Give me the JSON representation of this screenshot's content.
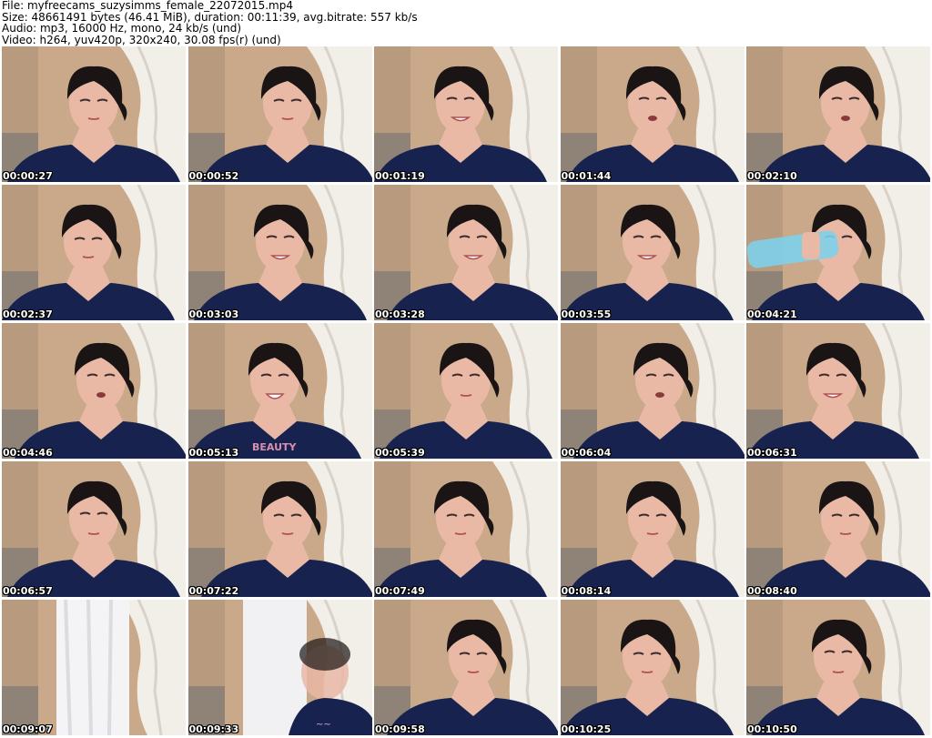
{
  "header": {
    "file": "File: myfreecams_suzysimms_female_22072015.mp4",
    "size": "Size: 48661491 bytes (46.41 MiB), duration: 00:11:39, avg.bitrate: 557 kb/s",
    "audio": "Audio: mp3, 16000 Hz, mono, 24 kb/s (und)",
    "video": "Video: h264, yuv420p, 320x240, 30.08 fps(r) (und)"
  },
  "colors": {
    "wall": "#c9a98a",
    "curtain": "#f2eee8",
    "shirt": "#17234e",
    "hair": "#1a1414",
    "skin": "#e9b9a6"
  },
  "thumbnails": [
    {
      "time": "00:00:27",
      "variant": "look-down"
    },
    {
      "time": "00:00:52",
      "variant": "look-down"
    },
    {
      "time": "00:01:19",
      "variant": "smile"
    },
    {
      "time": "00:01:44",
      "variant": "talk"
    },
    {
      "time": "00:02:10",
      "variant": "talk"
    },
    {
      "time": "00:02:37",
      "variant": "look-down"
    },
    {
      "time": "00:03:03",
      "variant": "smile"
    },
    {
      "time": "00:03:28",
      "variant": "smile"
    },
    {
      "time": "00:03:55",
      "variant": "smile"
    },
    {
      "time": "00:04:21",
      "variant": "drink"
    },
    {
      "time": "00:04:46",
      "variant": "talk"
    },
    {
      "time": "00:05:13",
      "variant": "laugh"
    },
    {
      "time": "00:05:39",
      "variant": "neutral"
    },
    {
      "time": "00:06:04",
      "variant": "talk"
    },
    {
      "time": "00:06:31",
      "variant": "smile"
    },
    {
      "time": "00:06:57",
      "variant": "neutral"
    },
    {
      "time": "00:07:22",
      "variant": "look-down"
    },
    {
      "time": "00:07:49",
      "variant": "look-down"
    },
    {
      "time": "00:08:14",
      "variant": "look-down"
    },
    {
      "time": "00:08:40",
      "variant": "look-down"
    },
    {
      "time": "00:09:07",
      "variant": "empty"
    },
    {
      "time": "00:09:33",
      "variant": "blur"
    },
    {
      "time": "00:09:58",
      "variant": "look-down"
    },
    {
      "time": "00:10:25",
      "variant": "look-down"
    },
    {
      "time": "00:10:50",
      "variant": "neutral"
    }
  ]
}
